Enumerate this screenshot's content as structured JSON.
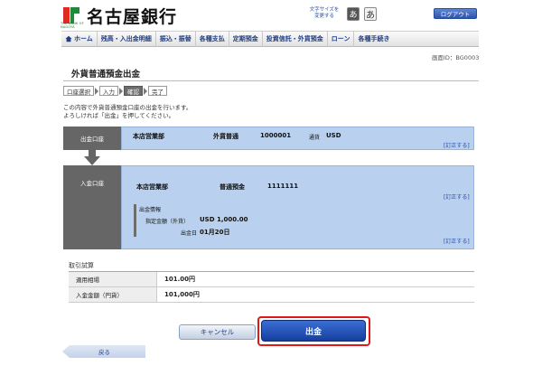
{
  "header": {
    "bank_name": "名古屋銀行",
    "logo_sub": "THE BANK OF NAGOYA",
    "font_size_label": "文字サイズを変更する",
    "font_small": "あ",
    "font_large": "あ",
    "logout": "ログアウト"
  },
  "nav": {
    "items": [
      "ホーム",
      "残高・入出金明細",
      "振込・振替",
      "各種支払",
      "定期預金",
      "投資信託・外貨預金",
      "ローン",
      "各種手続き"
    ]
  },
  "screen_id": "画面ID：BG0003",
  "page_title": "外貨普通預金出金",
  "steps": [
    "口座選択",
    "入力",
    "確認",
    "完了"
  ],
  "instructions": [
    "この内容で外貨普通預金口座の出金を行います。",
    "よろしければ「出金」を押してください。"
  ],
  "debit": {
    "label": "出金口座",
    "branch": "本店営業部",
    "type": "外貨普通",
    "number": "1000001",
    "currency_label": "通貨",
    "currency": "USD",
    "edit": "[訂正する]"
  },
  "credit": {
    "label": "入金口座",
    "branch": "本店営業部",
    "type": "普通預金",
    "number": "1111111",
    "edit": "[訂正する]",
    "fx_info_label": "出金情報",
    "amount_label": "指定金額（外貨）",
    "amount": "USD 1,000.00",
    "date_label": "出金日",
    "date": "01月20日",
    "edit2": "[訂正する]"
  },
  "trial": {
    "title": "取引試算",
    "rows": [
      {
        "label": "適用相場",
        "value": "101.00円"
      },
      {
        "label": "入金金額（円貨）",
        "value": "101,000円"
      }
    ]
  },
  "buttons": {
    "cancel": "キャンセル",
    "submit": "出金",
    "back": "戻る"
  },
  "colors": {
    "accent_blue": "#2c55ad",
    "panel_blue": "#b9d1ee",
    "highlight_red": "#e01818"
  }
}
